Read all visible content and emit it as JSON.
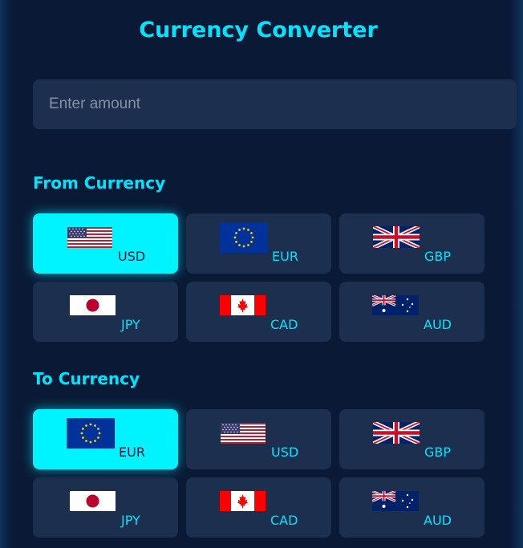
{
  "title": "Currency Converter",
  "amount": {
    "placeholder": "Enter amount",
    "value": ""
  },
  "from_section": {
    "label": "From Currency",
    "selected": "USD",
    "options": [
      {
        "code": "USD",
        "flag": "us-flag-icon"
      },
      {
        "code": "EUR",
        "flag": "eu-flag-icon"
      },
      {
        "code": "GBP",
        "flag": "uk-flag-icon"
      },
      {
        "code": "JPY",
        "flag": "jp-flag-icon"
      },
      {
        "code": "CAD",
        "flag": "ca-flag-icon"
      },
      {
        "code": "AUD",
        "flag": "au-flag-icon"
      }
    ]
  },
  "to_section": {
    "label": "To Currency",
    "selected": "EUR",
    "options": [
      {
        "code": "EUR",
        "flag": "eu-flag-icon"
      },
      {
        "code": "USD",
        "flag": "us-flag-icon"
      },
      {
        "code": "GBP",
        "flag": "uk-flag-icon"
      },
      {
        "code": "JPY",
        "flag": "jp-flag-icon"
      },
      {
        "code": "CAD",
        "flag": "ca-flag-icon"
      },
      {
        "code": "AUD",
        "flag": "au-flag-icon"
      }
    ]
  },
  "colors": {
    "background": "#0a1a36",
    "card": "#1c2f4e",
    "accent": "#00e5ff",
    "active": "#00f4ff"
  }
}
